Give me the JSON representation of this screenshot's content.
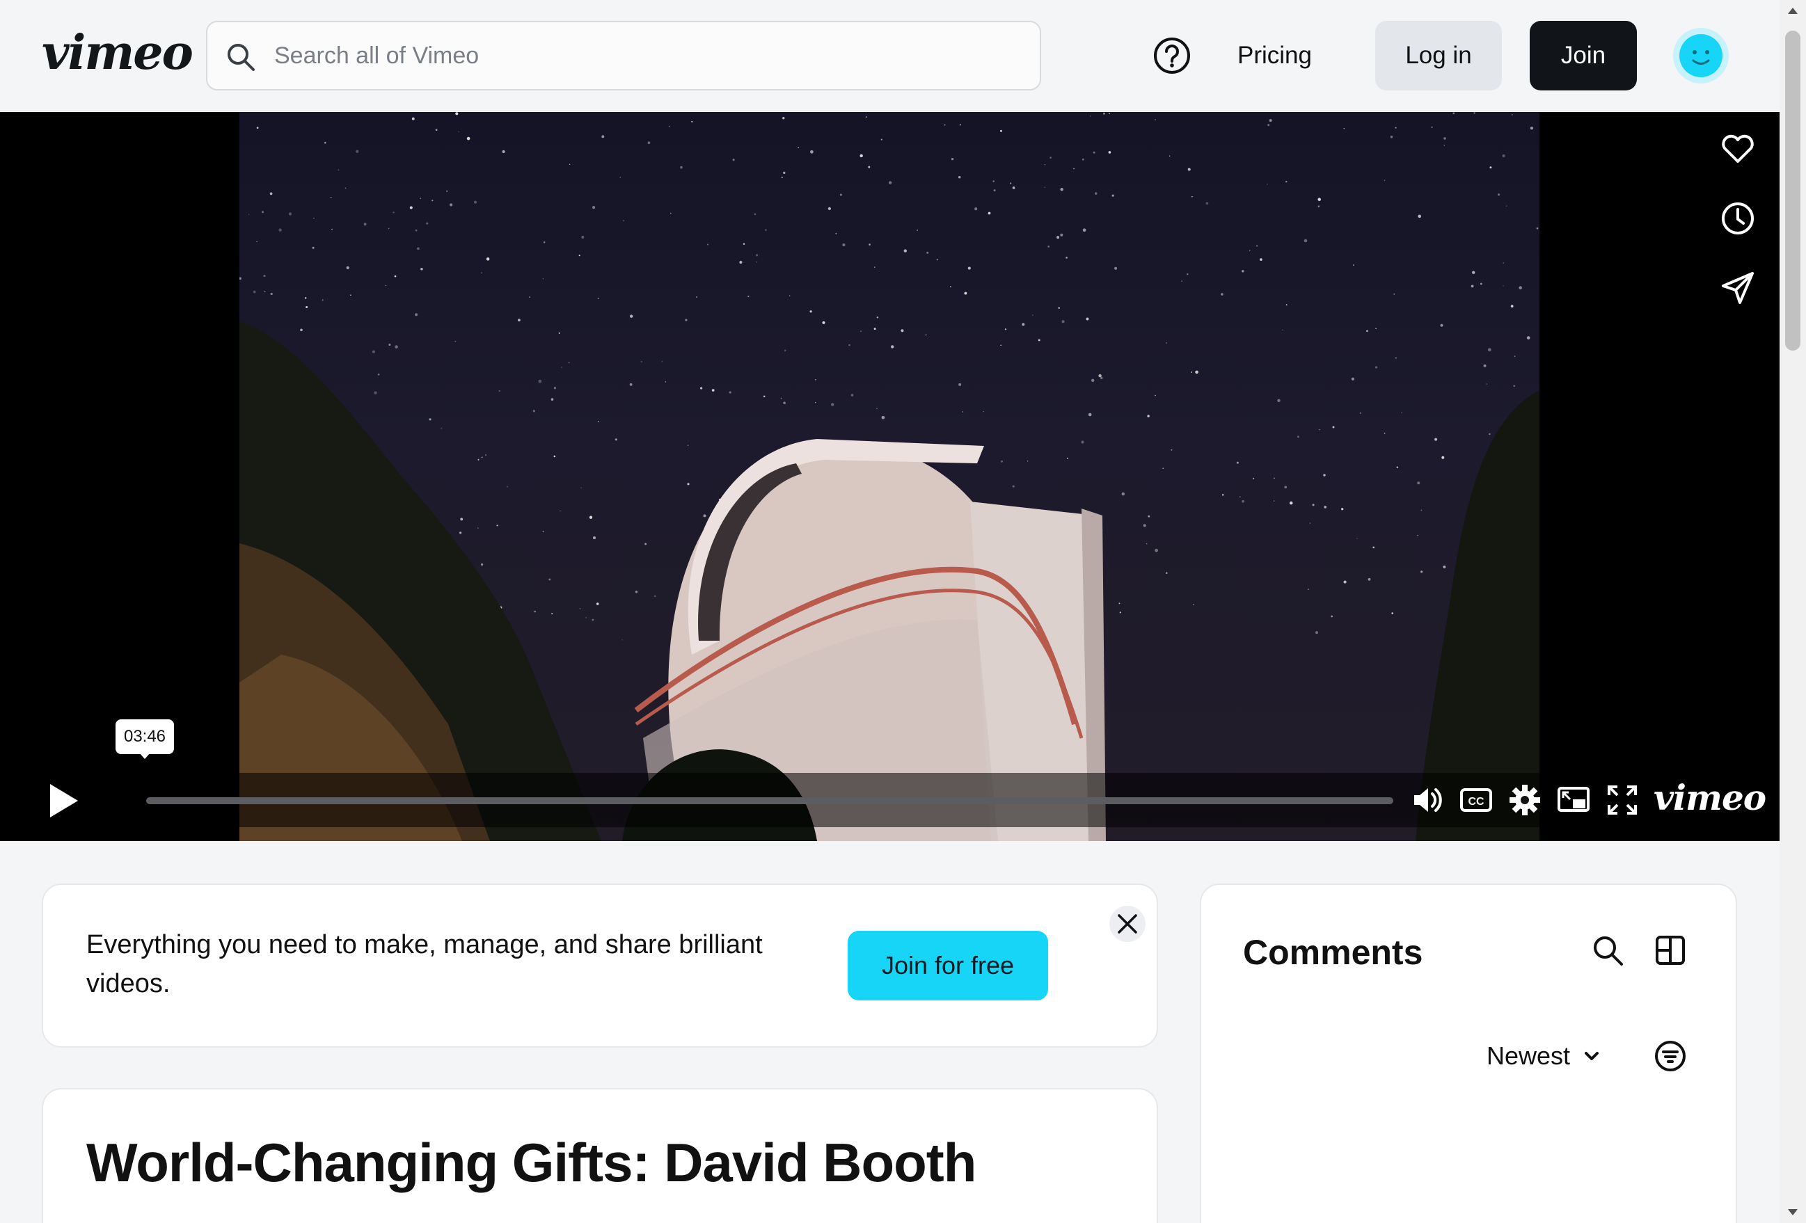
{
  "header": {
    "logo": "vimeo",
    "search_placeholder": "Search all of Vimeo",
    "pricing_label": "Pricing",
    "login_label": "Log in",
    "join_label": "Join"
  },
  "player": {
    "hover_time": "03:46",
    "progress": 0,
    "logo": "vimeo",
    "side_actions": [
      "heart-icon",
      "clock-icon",
      "share-icon"
    ],
    "controls": [
      "volume-icon",
      "cc-icon",
      "settings-icon",
      "pip-icon",
      "fullscreen-icon"
    ]
  },
  "banner": {
    "text": "Everything you need to make, manage, and share brilliant videos.",
    "cta_label": "Join for free"
  },
  "video": {
    "title": "World-Changing Gifts: David Booth"
  },
  "comments": {
    "heading": "Comments",
    "sort_label": "Newest"
  },
  "colors": {
    "accent": "#17d5f6",
    "dark_button": "#111418",
    "page_background": "#f4f5f7"
  }
}
